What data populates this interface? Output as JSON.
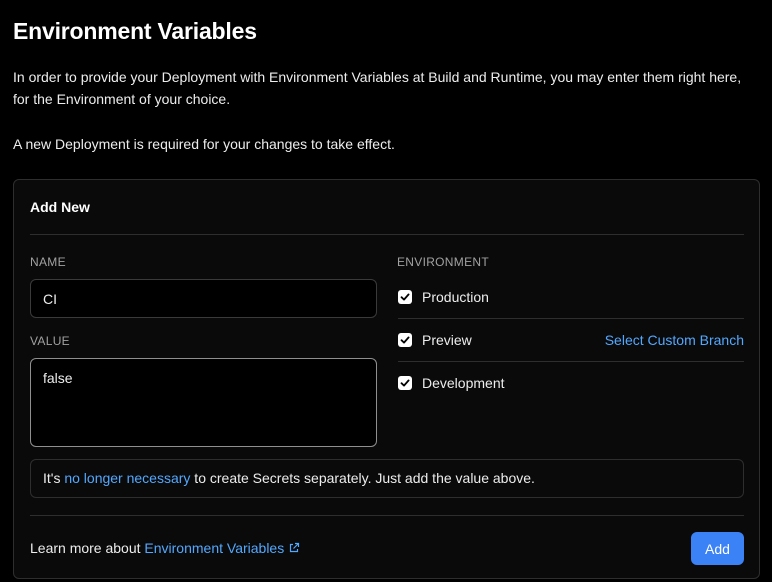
{
  "page": {
    "title": "Environment Variables",
    "intro": "In order to provide your Deployment with Environment Variables at Build and Runtime, you may enter them right here, for the Environment of your choice.",
    "note": "A new Deployment is required for your changes to take effect."
  },
  "form": {
    "card_title": "Add New",
    "name_label": "NAME",
    "name_value": "CI",
    "value_label": "VALUE",
    "value_value": "false",
    "environment_label": "ENVIRONMENT",
    "environments": [
      {
        "label": "Production",
        "checked": true
      },
      {
        "label": "Preview",
        "checked": true
      },
      {
        "label": "Development",
        "checked": true
      }
    ],
    "custom_branch_link": "Select Custom Branch",
    "info": {
      "prefix": "It's ",
      "link": "no longer necessary",
      "suffix": " to create Secrets separately. Just add the value above."
    },
    "footer": {
      "prefix": "Learn more about ",
      "link": "Environment Variables"
    },
    "add_button": "Add"
  },
  "icons": {
    "checkmark": "check-icon",
    "external_link": "external-link-icon"
  },
  "colors": {
    "background": "#000000",
    "card": "#0a0a0a",
    "border": "#2e2e2e",
    "link": "#52a8ff",
    "primary_button": "#3b82f6"
  }
}
